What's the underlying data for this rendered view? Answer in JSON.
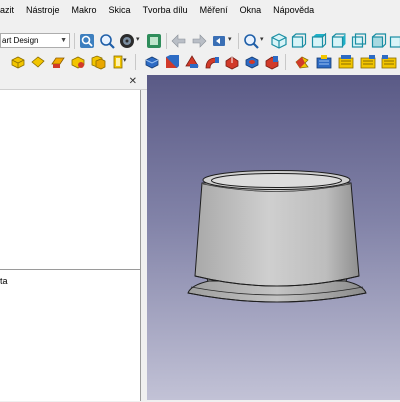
{
  "menu": [
    "azit",
    "Nástroje",
    "Makro",
    "Skica",
    "Tvorba dílu",
    "Měření",
    "Okna",
    "Nápověda"
  ],
  "workbench": {
    "selected": "art Design"
  },
  "property_panel": {
    "label": "ta"
  },
  "icons": {
    "toolbar1": [
      "zoom-fit-all-icon",
      "zoom-fit-selection-icon",
      "draw-style-icon",
      "sync-view-icon",
      "back-arrow-icon",
      "forward-arrow-icon",
      "workbench-arrow-icon",
      "zoom-icon",
      "isometric-view-icon",
      "front-view-icon",
      "top-view-icon",
      "right-view-icon",
      "rear-view-icon",
      "bottom-view-icon"
    ],
    "toolbar2": [
      "create-body-icon",
      "create-part-icon",
      "shape-binder-icon",
      "sub-shape-binder-icon",
      "clone-icon",
      "pad-icon",
      "revolution-icon",
      "loft-icon",
      "pipe-icon",
      "pocket-icon",
      "hole-icon",
      "groove-icon",
      "subtractive-loft-icon",
      "subtractive-pipe-icon",
      "fillet-icon",
      "chamfer-icon",
      "draft-icon",
      "thickness-icon"
    ]
  },
  "colors": {
    "viewport_top": "#5a5a86",
    "viewport_bottom": "#c2c2d6",
    "model": "#c9c9c9"
  }
}
